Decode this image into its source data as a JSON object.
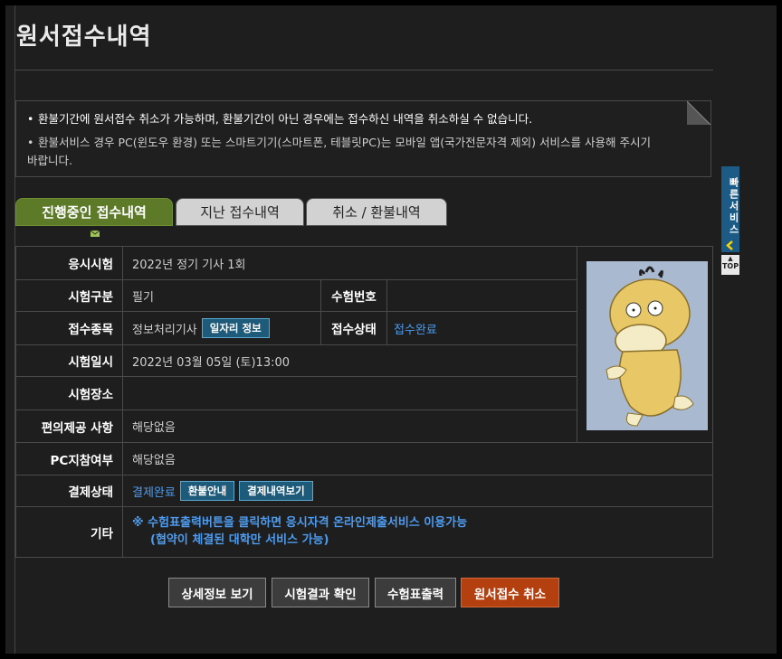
{
  "page": {
    "title": "원서접수내역"
  },
  "notice": {
    "line1": "환불기간에 원서접수 취소가 가능하며, 환불기간이 아닌 경우에는 접수하신 내역을 취소하실 수 없습니다.",
    "line2": "환불서비스 경우 PC(윈도우 환경) 또는 스마트기기(스마트폰, 테블릿PC)는 모바일 앱(국가전문자격 제외) 서비스를 사용해 주시기 바랍니다.",
    "bullet": "•"
  },
  "tabs": [
    {
      "label": "진행중인 접수내역",
      "active": true
    },
    {
      "label": "지난 접수내역",
      "active": false
    },
    {
      "label": "취소 / 환불내역",
      "active": false
    }
  ],
  "details": {
    "exam_label": "응시시험",
    "exam_value": "2022년 정기 기사 1회",
    "type_label": "시험구분",
    "type_value": "필기",
    "number_label": "수험번호",
    "number_value": "",
    "category_label": "접수종목",
    "category_value": "정보처리기사",
    "job_info_button": "일자리 정보",
    "status_label": "접수상태",
    "status_value": "접수완료",
    "datetime_label": "시험일시",
    "datetime_value": "2022년 03월 05일 (토)13:00",
    "place_label": "시험장소",
    "place_value": "",
    "convenience_label": "편의제공 사항",
    "convenience_value": "해당없음",
    "pc_label": "PC지참여부",
    "pc_value": "해당없음",
    "payment_label": "결제상태",
    "payment_value": "결제완료",
    "refund_button": "환불안내",
    "payment_history_button": "결제내역보기",
    "etc_label": "기타",
    "etc_line1": "※ 수험표출력버튼을 클릭하면 응시자격 온라인제출서비스 이용가능",
    "etc_line2": "(협약이 체결된 대학만 서비스 가능)"
  },
  "actions": {
    "detail": "상세정보 보기",
    "result": "시험결과 확인",
    "print": "수험표출력",
    "cancel": "원서접수 취소"
  },
  "side": {
    "quick_service": "빠른서비스",
    "top": "TOP"
  },
  "colors": {
    "background": "#1e1e1e",
    "active_tab": "#5c7a27",
    "link_blue": "#4d9cf0",
    "cancel_button": "#b5400f",
    "mini_button": "#1e5a7a"
  },
  "icons": {
    "collapse": "chevron-left-icon",
    "fold": "page-fold-icon",
    "tab_marker": "envelope-icon"
  }
}
